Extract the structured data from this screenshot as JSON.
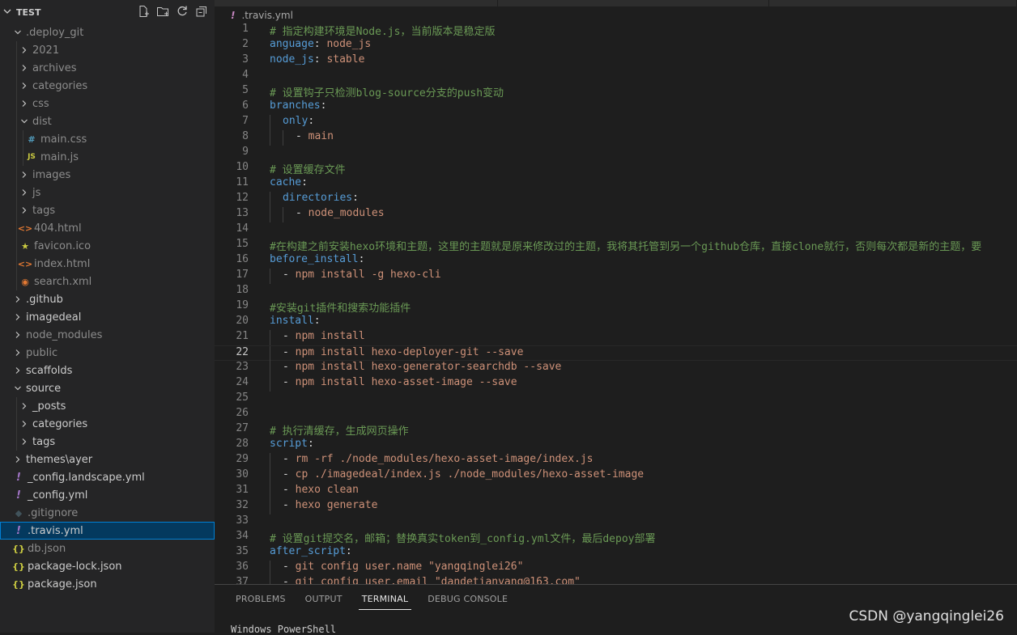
{
  "explorer": {
    "title": "TEST",
    "actions": [
      "new-file-icon",
      "new-folder-icon",
      "refresh-icon",
      "collapse-all-icon"
    ],
    "items": [
      {
        "label": ".deploy_git",
        "depth": 1,
        "type": "folder",
        "open": true,
        "dim": true
      },
      {
        "label": "2021",
        "depth": 2,
        "type": "folder",
        "open": false,
        "dim": true
      },
      {
        "label": "archives",
        "depth": 2,
        "type": "folder",
        "open": false,
        "dim": true
      },
      {
        "label": "categories",
        "depth": 2,
        "type": "folder",
        "open": false,
        "dim": true
      },
      {
        "label": "css",
        "depth": 2,
        "type": "folder",
        "open": false,
        "dim": true
      },
      {
        "label": "dist",
        "depth": 2,
        "type": "folder",
        "open": true,
        "dim": true
      },
      {
        "label": "main.css",
        "depth": 3,
        "type": "css",
        "dim": true
      },
      {
        "label": "main.js",
        "depth": 3,
        "type": "js",
        "dim": true
      },
      {
        "label": "images",
        "depth": 2,
        "type": "folder",
        "open": false,
        "dim": true
      },
      {
        "label": "js",
        "depth": 2,
        "type": "folder",
        "open": false,
        "dim": true
      },
      {
        "label": "tags",
        "depth": 2,
        "type": "folder",
        "open": false,
        "dim": true
      },
      {
        "label": "404.html",
        "depth": 2,
        "type": "html",
        "dim": true
      },
      {
        "label": "favicon.ico",
        "depth": 2,
        "type": "star",
        "dim": true
      },
      {
        "label": "index.html",
        "depth": 2,
        "type": "html",
        "dim": true
      },
      {
        "label": "search.xml",
        "depth": 2,
        "type": "rss",
        "dim": true
      },
      {
        "label": ".github",
        "depth": 1,
        "type": "folder",
        "open": false
      },
      {
        "label": "imagedeal",
        "depth": 1,
        "type": "folder",
        "open": false
      },
      {
        "label": "node_modules",
        "depth": 1,
        "type": "folder",
        "open": false,
        "dim": true
      },
      {
        "label": "public",
        "depth": 1,
        "type": "folder",
        "open": false,
        "dim": true
      },
      {
        "label": "scaffolds",
        "depth": 1,
        "type": "folder",
        "open": false
      },
      {
        "label": "source",
        "depth": 1,
        "type": "folder",
        "open": true
      },
      {
        "label": "_posts",
        "depth": 2,
        "type": "folder",
        "open": false
      },
      {
        "label": "categories",
        "depth": 2,
        "type": "folder",
        "open": false
      },
      {
        "label": "tags",
        "depth": 2,
        "type": "folder",
        "open": false
      },
      {
        "label": "themes\\ayer",
        "depth": 1,
        "type": "folder",
        "open": false
      },
      {
        "label": "_config.landscape.yml",
        "depth": 1,
        "type": "yml"
      },
      {
        "label": "_config.yml",
        "depth": 1,
        "type": "yml"
      },
      {
        "label": ".gitignore",
        "depth": 1,
        "type": "git",
        "dim": true
      },
      {
        "label": ".travis.yml",
        "depth": 1,
        "type": "yml",
        "selected": true
      },
      {
        "label": "db.json",
        "depth": 1,
        "type": "json",
        "dim": true
      },
      {
        "label": "package-lock.json",
        "depth": 1,
        "type": "json"
      },
      {
        "label": "package.json",
        "depth": 1,
        "type": "json"
      }
    ]
  },
  "editor": {
    "breadcrumb_icon": "!",
    "breadcrumb_file": ".travis.yml",
    "active_line": 22,
    "lines": [
      {
        "n": 1,
        "indent": 0,
        "parts": [
          [
            "comment",
            "# 指定构建环境是Node.js，当前版本是稳定版"
          ]
        ]
      },
      {
        "n": 2,
        "indent": 0,
        "parts": [
          [
            "key",
            "anguage"
          ],
          [
            "punc",
            ": "
          ],
          [
            "plain",
            "node_js"
          ]
        ]
      },
      {
        "n": 3,
        "indent": 0,
        "parts": [
          [
            "key",
            "node_js"
          ],
          [
            "punc",
            ": "
          ],
          [
            "plain",
            "stable"
          ]
        ]
      },
      {
        "n": 4,
        "indent": 0,
        "parts": []
      },
      {
        "n": 5,
        "indent": 0,
        "parts": [
          [
            "comment",
            "# 设置钩子只检测blog-source分支的push变动"
          ]
        ]
      },
      {
        "n": 6,
        "indent": 0,
        "parts": [
          [
            "key",
            "branches"
          ],
          [
            "punc",
            ":"
          ]
        ]
      },
      {
        "n": 7,
        "indent": 1,
        "parts": [
          [
            "key",
            "only"
          ],
          [
            "punc",
            ":"
          ]
        ]
      },
      {
        "n": 8,
        "indent": 2,
        "parts": [
          [
            "punc",
            "- "
          ],
          [
            "plain",
            "main"
          ]
        ]
      },
      {
        "n": 9,
        "indent": 0,
        "parts": []
      },
      {
        "n": 10,
        "indent": 0,
        "parts": [
          [
            "comment",
            "# 设置缓存文件"
          ]
        ]
      },
      {
        "n": 11,
        "indent": 0,
        "parts": [
          [
            "key",
            "cache"
          ],
          [
            "punc",
            ":"
          ]
        ]
      },
      {
        "n": 12,
        "indent": 1,
        "parts": [
          [
            "key",
            "directories"
          ],
          [
            "punc",
            ":"
          ]
        ]
      },
      {
        "n": 13,
        "indent": 2,
        "parts": [
          [
            "punc",
            "- "
          ],
          [
            "plain",
            "node_modules"
          ]
        ]
      },
      {
        "n": 14,
        "indent": 0,
        "parts": []
      },
      {
        "n": 15,
        "indent": 0,
        "parts": [
          [
            "comment",
            "#在构建之前安装hexo环境和主题，这里的主题就是原来修改过的主题，我将其托管到另一个github仓库，直接clone就行，否则每次都是新的主题，要"
          ]
        ]
      },
      {
        "n": 16,
        "indent": 0,
        "parts": [
          [
            "key",
            "before_install"
          ],
          [
            "punc",
            ":"
          ]
        ]
      },
      {
        "n": 17,
        "indent": 1,
        "parts": [
          [
            "punc",
            "- "
          ],
          [
            "plain",
            "npm install -g hexo-cli"
          ]
        ]
      },
      {
        "n": 18,
        "indent": 0,
        "parts": []
      },
      {
        "n": 19,
        "indent": 0,
        "parts": [
          [
            "comment",
            "#安装git插件和搜索功能插件"
          ]
        ]
      },
      {
        "n": 20,
        "indent": 0,
        "parts": [
          [
            "key",
            "install"
          ],
          [
            "punc",
            ":"
          ]
        ]
      },
      {
        "n": 21,
        "indent": 1,
        "parts": [
          [
            "punc",
            "- "
          ],
          [
            "plain",
            "npm install"
          ]
        ]
      },
      {
        "n": 22,
        "indent": 1,
        "parts": [
          [
            "punc",
            "- "
          ],
          [
            "plain",
            "npm install hexo-deployer-git --save"
          ]
        ]
      },
      {
        "n": 23,
        "indent": 1,
        "parts": [
          [
            "punc",
            "- "
          ],
          [
            "plain",
            "npm install hexo-generator-searchdb --save"
          ]
        ]
      },
      {
        "n": 24,
        "indent": 1,
        "parts": [
          [
            "punc",
            "- "
          ],
          [
            "plain",
            "npm install hexo-asset-image --save"
          ]
        ]
      },
      {
        "n": 25,
        "indent": 0,
        "parts": []
      },
      {
        "n": 26,
        "indent": 0,
        "parts": []
      },
      {
        "n": 27,
        "indent": 0,
        "parts": [
          [
            "comment",
            "# 执行清缓存，生成网页操作"
          ]
        ]
      },
      {
        "n": 28,
        "indent": 0,
        "parts": [
          [
            "key",
            "script"
          ],
          [
            "punc",
            ":"
          ]
        ]
      },
      {
        "n": 29,
        "indent": 1,
        "parts": [
          [
            "punc",
            "- "
          ],
          [
            "plain",
            "rm -rf ./node_modules/hexo-asset-image/index.js"
          ]
        ]
      },
      {
        "n": 30,
        "indent": 1,
        "parts": [
          [
            "punc",
            "- "
          ],
          [
            "plain",
            "cp ./imagedeal/index.js ./node_modules/hexo-asset-image"
          ]
        ]
      },
      {
        "n": 31,
        "indent": 1,
        "parts": [
          [
            "punc",
            "- "
          ],
          [
            "plain",
            "hexo clean"
          ]
        ]
      },
      {
        "n": 32,
        "indent": 1,
        "parts": [
          [
            "punc",
            "- "
          ],
          [
            "plain",
            "hexo generate"
          ]
        ]
      },
      {
        "n": 33,
        "indent": 0,
        "parts": []
      },
      {
        "n": 34,
        "indent": 0,
        "parts": [
          [
            "comment",
            "# 设置git提交名，邮箱；替换真实token到_config.yml文件，最后depoy部署"
          ]
        ]
      },
      {
        "n": 35,
        "indent": 0,
        "parts": [
          [
            "key",
            "after_script"
          ],
          [
            "punc",
            ":"
          ]
        ]
      },
      {
        "n": 36,
        "indent": 1,
        "parts": [
          [
            "punc",
            "- "
          ],
          [
            "plain",
            "git config user.name \"yangqinglei26\""
          ]
        ]
      },
      {
        "n": 37,
        "indent": 1,
        "parts": [
          [
            "punc",
            "- "
          ],
          [
            "plain",
            "git config user.email \"dandetianyang@163.com\""
          ]
        ]
      }
    ]
  },
  "panel": {
    "tabs": [
      "PROBLEMS",
      "OUTPUT",
      "TERMINAL",
      "DEBUG CONSOLE"
    ],
    "active_tab": "TERMINAL",
    "terminal_text": "Windows PowerShell"
  },
  "watermark": "CSDN @yangqinglei26"
}
